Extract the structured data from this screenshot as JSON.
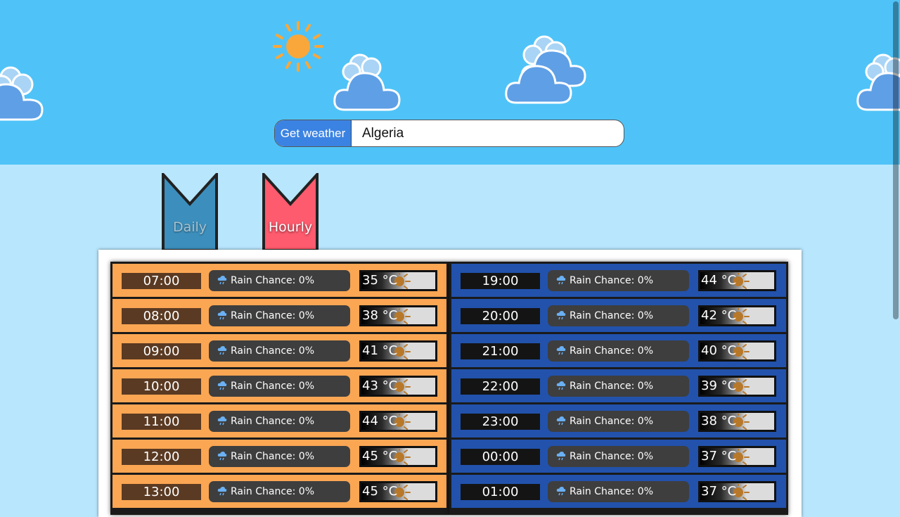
{
  "search": {
    "button_label": "Get weather",
    "value": "Algeria"
  },
  "tabs": [
    {
      "label": "Daily",
      "color": "#3c8fbd"
    },
    {
      "label": "Hourly",
      "color": "#ff5b6e"
    }
  ],
  "hours_left": [
    {
      "time": "07:00",
      "rain": "Rain Chance: 0%",
      "temp": "35 °C"
    },
    {
      "time": "08:00",
      "rain": "Rain Chance: 0%",
      "temp": "38 °C"
    },
    {
      "time": "09:00",
      "rain": "Rain Chance: 0%",
      "temp": "41 °C"
    },
    {
      "time": "10:00",
      "rain": "Rain Chance: 0%",
      "temp": "43 °C"
    },
    {
      "time": "11:00",
      "rain": "Rain Chance: 0%",
      "temp": "44 °C"
    },
    {
      "time": "12:00",
      "rain": "Rain Chance: 0%",
      "temp": "45 °C"
    },
    {
      "time": "13:00",
      "rain": "Rain Chance: 0%",
      "temp": "45 °C"
    }
  ],
  "hours_right": [
    {
      "time": "19:00",
      "rain": "Rain Chance: 0%",
      "temp": "44 °C"
    },
    {
      "time": "20:00",
      "rain": "Rain Chance: 0%",
      "temp": "42 °C"
    },
    {
      "time": "21:00",
      "rain": "Rain Chance: 0%",
      "temp": "40 °C"
    },
    {
      "time": "22:00",
      "rain": "Rain Chance: 0%",
      "temp": "39 °C"
    },
    {
      "time": "23:00",
      "rain": "Rain Chance: 0%",
      "temp": "38 °C"
    },
    {
      "time": "00:00",
      "rain": "Rain Chance: 0%",
      "temp": "37 °C"
    },
    {
      "time": "01:00",
      "rain": "Rain Chance: 0%",
      "temp": "37 °C"
    }
  ],
  "colors": {
    "header_bg": "#4fc3f7",
    "page_bg": "#b8e6fd",
    "day_rows": "#fba653",
    "night_rows": "#2252ac",
    "search_button": "#3b83e2"
  },
  "icons": {
    "rain": "raindrop-cloud-icon",
    "temperature": "sun-icon"
  }
}
